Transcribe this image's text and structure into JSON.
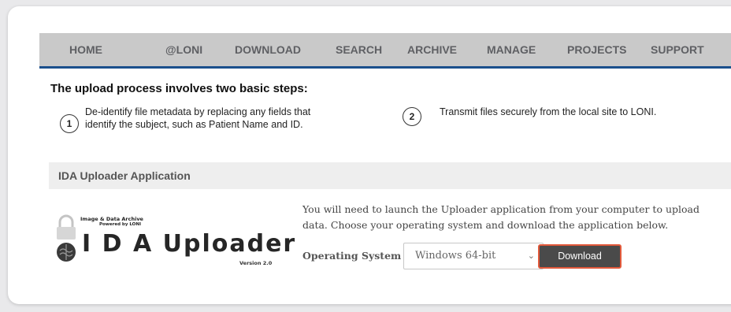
{
  "nav": {
    "items": [
      {
        "label": "HOME"
      },
      {
        "label": "@LONI"
      },
      {
        "label": "DOWNLOAD"
      },
      {
        "label": "SEARCH"
      },
      {
        "label": "ARCHIVE"
      },
      {
        "label": "MANAGE"
      },
      {
        "label": "PROJECTS"
      },
      {
        "label": "SUPPORT"
      }
    ],
    "accent_color": "#1b4f8c"
  },
  "steps": {
    "title": "The upload process involves two basic steps:",
    "items": [
      {
        "number": "1",
        "text": "De-identify file metadata by replacing any fields that identify the subject, such as Patient Name and ID."
      },
      {
        "number": "2",
        "text": "Transmit files securely from the local site to LONI."
      }
    ]
  },
  "uploader": {
    "section_title": "IDA Uploader Application",
    "logo": {
      "top_text": "Image & Data Archive",
      "sub_text": "Powered by LONI",
      "main_text": "I D A Uploader",
      "version": "Version 2.0",
      "icons": [
        "brain-icon",
        "padlock-icon"
      ]
    },
    "description": "You will need to launch the Uploader application from your computer to upload data. Choose your operating system and download the application below.",
    "os_label": "Operating System",
    "os_selected": "Windows 64-bit",
    "download_label": "Download",
    "download_highlight_color": "#e2593b"
  }
}
